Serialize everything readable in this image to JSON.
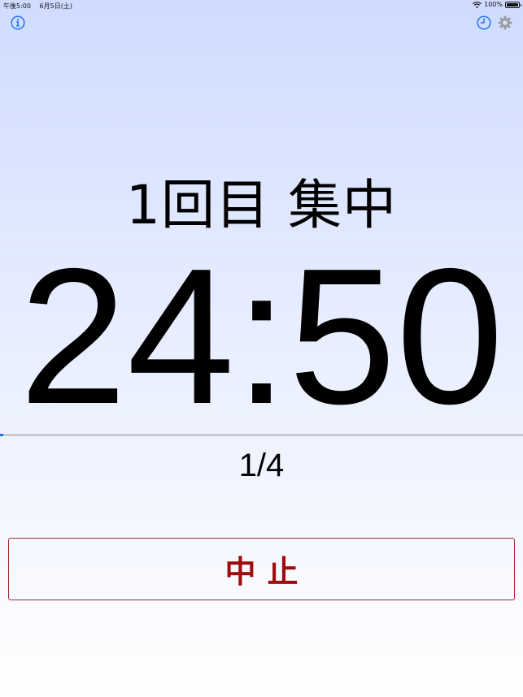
{
  "status_bar": {
    "time": "午後5:00",
    "date": "6月5日(土)",
    "battery": "100%",
    "battery_level": 1.0
  },
  "toolbar": {
    "info_icon": "info-icon",
    "history_icon": "clock-icon",
    "settings_icon": "gear-icon",
    "accent_color": "#1a6ff0"
  },
  "session": {
    "phase_label": "1回目 集中",
    "timer": "24:50",
    "progress_fraction": 0.0067,
    "round_count": "1/4"
  },
  "actions": {
    "stop_label": "中止",
    "stop_color": "#9e0d0d"
  }
}
